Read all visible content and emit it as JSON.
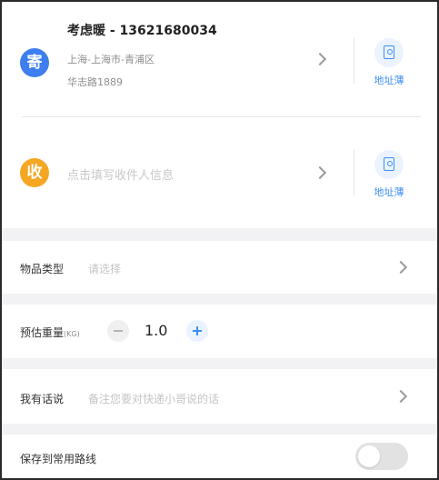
{
  "sender": {
    "badge": "寄",
    "name_phone": "考虑暖 - 13621680034",
    "region": "上海-上海市-青浦区",
    "street": "华志路1889",
    "address_book_label": "地址薄"
  },
  "receiver": {
    "badge": "收",
    "placeholder": "点击填写收件人信息",
    "address_book_label": "地址薄"
  },
  "item_type": {
    "label": "物品类型",
    "placeholder": "请选择"
  },
  "weight": {
    "label": "预估重量",
    "unit": "(KG)",
    "value": "1.0"
  },
  "message": {
    "label": "我有话说",
    "placeholder": "备注您要对快递小哥说的话"
  },
  "save_route": {
    "label": "保存到常用路线",
    "enabled": false
  },
  "colors": {
    "sender_badge": "#3d7ef0",
    "receiver_badge": "#f5a623",
    "accent": "#3d8ef0",
    "section_gap": "#f2f2f5"
  },
  "icons": [
    "chevron-right-icon",
    "address-book-icon",
    "minus-icon",
    "plus-icon"
  ]
}
